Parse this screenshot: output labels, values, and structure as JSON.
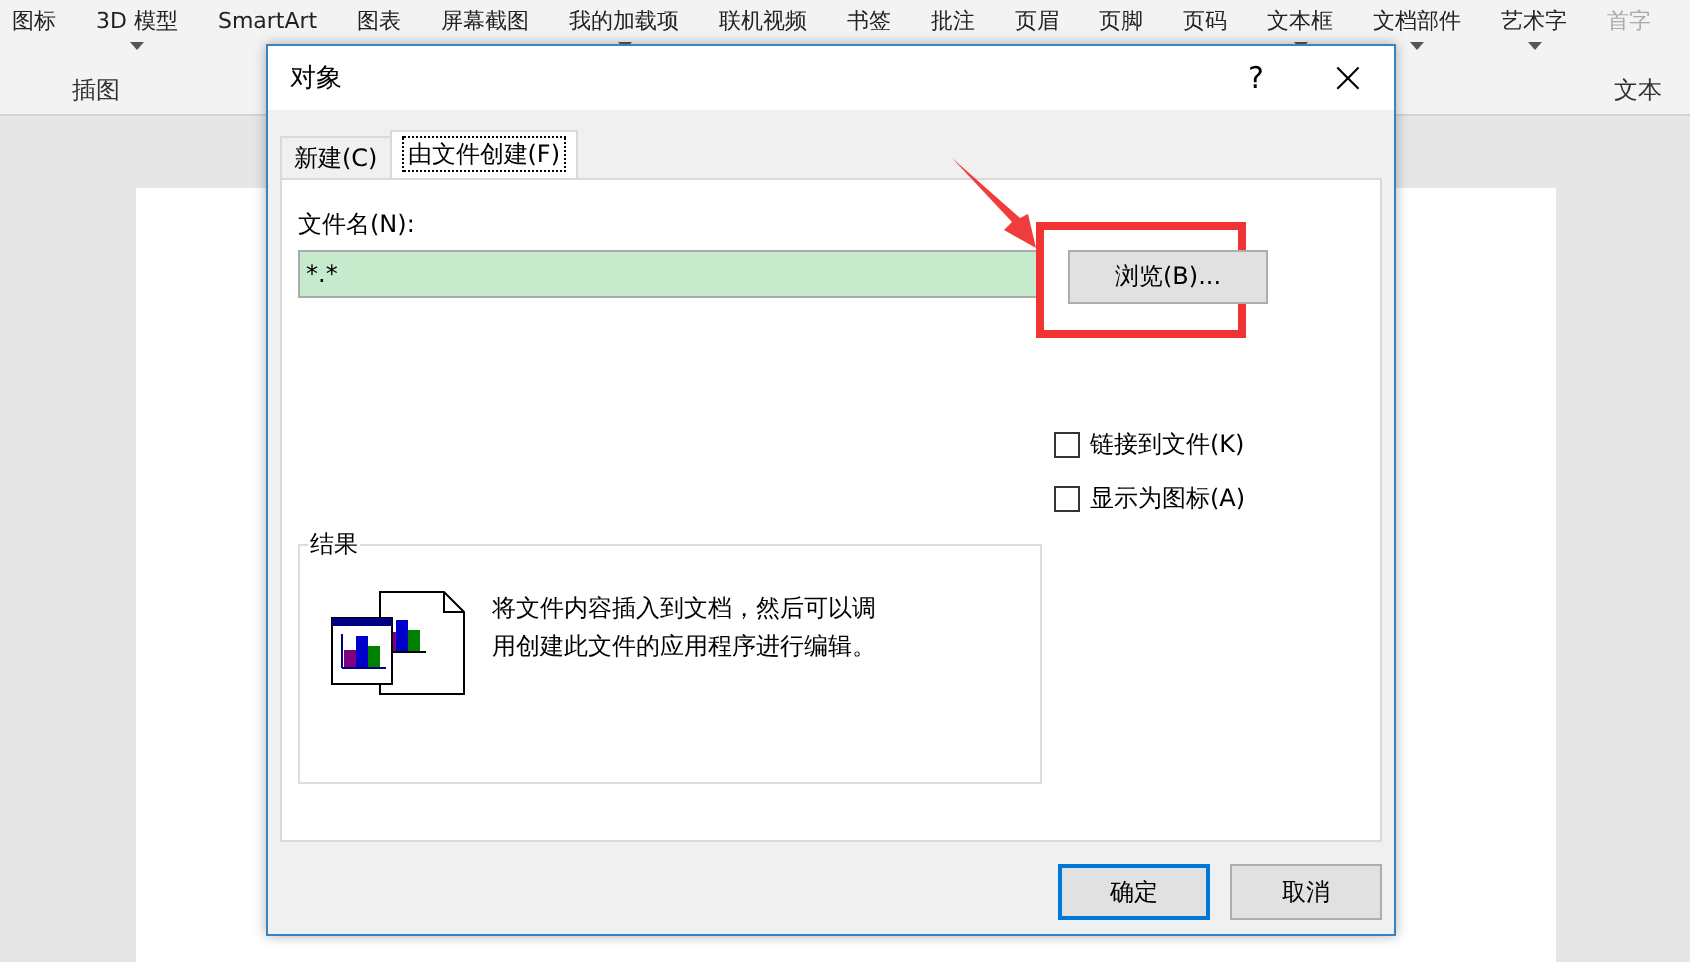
{
  "ribbon": {
    "items": [
      {
        "label": "图标",
        "menu": false,
        "disabled": false
      },
      {
        "label": "3D 模型",
        "menu": true,
        "disabled": false
      },
      {
        "label": "SmartArt",
        "menu": false,
        "disabled": false
      },
      {
        "label": "图表",
        "menu": false,
        "disabled": false
      },
      {
        "label": "屏幕截图",
        "menu": false,
        "disabled": false
      },
      {
        "label": "我的加载项",
        "menu": true,
        "disabled": false
      },
      {
        "label": "联机视频",
        "menu": false,
        "disabled": false
      },
      {
        "label": "书签",
        "menu": false,
        "disabled": false
      },
      {
        "label": "批注",
        "menu": false,
        "disabled": false
      },
      {
        "label": "页眉",
        "menu": false,
        "disabled": false
      },
      {
        "label": "页脚",
        "menu": false,
        "disabled": false
      },
      {
        "label": "页码",
        "menu": false,
        "disabled": false
      },
      {
        "label": "文本框",
        "menu": true,
        "disabled": false
      },
      {
        "label": "文档部件",
        "menu": true,
        "disabled": false
      },
      {
        "label": "艺术字",
        "menu": true,
        "disabled": false
      },
      {
        "label": "首字",
        "menu": false,
        "disabled": true
      }
    ],
    "groups": [
      "插图",
      "文本"
    ]
  },
  "dialog": {
    "title": "对象",
    "help": "?",
    "close": "×",
    "tabs": [
      {
        "label": "新建(C)",
        "selected": false
      },
      {
        "label": "由文件创建(F)",
        "selected": true
      }
    ],
    "file_label": "文件名(N):",
    "file_value": "*.*",
    "browse": "浏览(B)...",
    "checkboxes": [
      {
        "label": "链接到文件(K)",
        "checked": false
      },
      {
        "label": "显示为图标(A)",
        "checked": false
      }
    ],
    "result_title": "结果",
    "result_text": "将文件内容插入到文档，然后可以调用创建此文件的应用程序进行编辑。",
    "buttons": [
      {
        "label": "确定",
        "default": true
      },
      {
        "label": "取消",
        "default": false
      }
    ]
  }
}
